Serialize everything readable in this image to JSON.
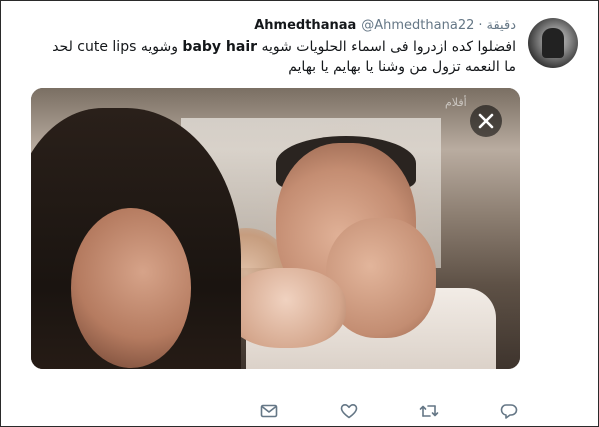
{
  "tweet": {
    "display_name": "Ahmedthanaa",
    "handle": "@Ahmedthana22",
    "separator": "·",
    "time": "دقيقة",
    "text_before_bold1": "افضلوا كده ازدروا فى اسماء الحلويات شويه ",
    "bold1": "baby hair",
    "text_between": " وشويه cute lips لحد ما النعمه تزول من وشنا يا بهايم يا بهايم",
    "media": {
      "watermark": "أفلام"
    }
  },
  "icons": {
    "close": "close-icon",
    "dm": "envelope-icon",
    "like": "heart-icon",
    "retweet": "retweet-icon",
    "reply": "reply-icon"
  },
  "colors": {
    "name": "#14171a",
    "meta": "#657786",
    "icon": "#657786",
    "overlay": "rgba(0,0,0,0.55)"
  }
}
